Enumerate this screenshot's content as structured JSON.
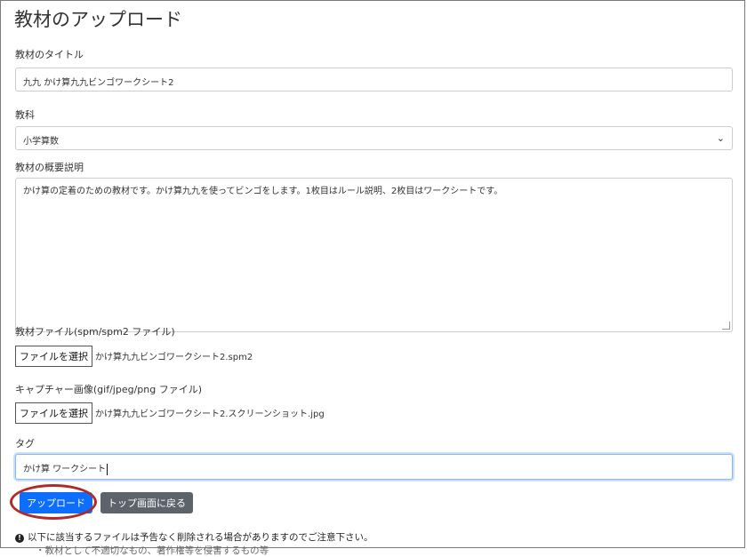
{
  "page": {
    "title": "教材のアップロード"
  },
  "form": {
    "title_label": "教材のタイトル",
    "title_value": "九九 かけ算九九ビンゴワークシート2",
    "subject_label": "教科",
    "subject_value": "小学算数",
    "description_label": "教材の概要説明",
    "description_value": "かけ算の定着のための教材です。かけ算九九を使ってビンゴをします。1枚目はルール説明、2枚目はワークシートです。",
    "file_label": "教材ファイル(spm/spm2 ファイル)",
    "file_button": "ファイルを選択",
    "file_name": "かけ算九九ビンゴワークシート2.spm2",
    "capture_label": "キャプチャー画像(gif/jpeg/png ファイル)",
    "capture_button": "ファイルを選択",
    "capture_name": "かけ算九九ビンゴワークシート2.スクリーンショット.jpg",
    "tag_label": "タグ",
    "tag_value": "かけ算 ワークシート"
  },
  "actions": {
    "upload": "アップロード",
    "back": "トップ画面に戻る"
  },
  "notice": {
    "icon": "info-circle-icon",
    "text": "以下に該当するファイルは予告なく削除される場合がありますのでご注意下さい。",
    "text2": "・教材として不適切なもの、著作権等を侵害するもの等"
  },
  "colors": {
    "primary": "#0d6efd",
    "secondary": "#5c636a",
    "highlight_circle": "#b02a2a"
  }
}
